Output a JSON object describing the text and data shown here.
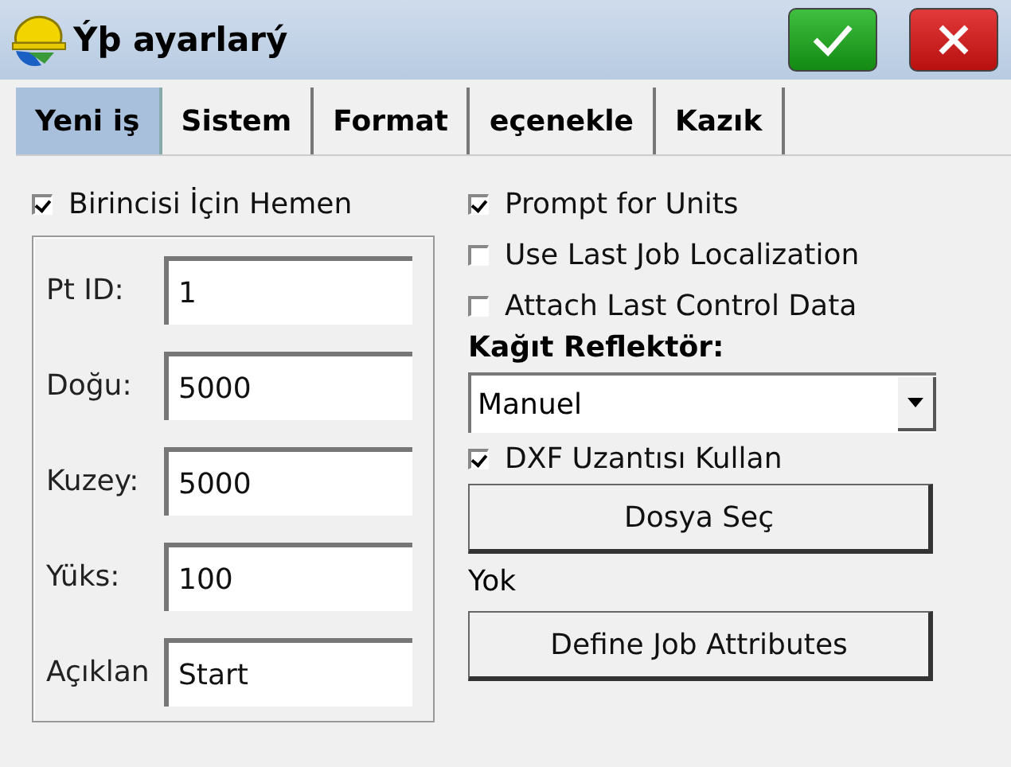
{
  "window": {
    "title": "Ýþ ayarlarý"
  },
  "title_buttons": [
    {
      "kind": "ok"
    },
    {
      "kind": "cancel"
    }
  ],
  "tabs": [
    {
      "label": "Yeni iş",
      "selected": true
    },
    {
      "label": "Sistem",
      "selected": false
    },
    {
      "label": "Format",
      "selected": false
    },
    {
      "label": "eçenekle",
      "selected": false
    },
    {
      "label": "Kazık",
      "selected": false
    }
  ],
  "left_checkbox": {
    "label": "Birincisi İçin Hemen",
    "checked": true
  },
  "fields": [
    {
      "label": "Pt ID:",
      "value": "1"
    },
    {
      "label": "Doğu:",
      "value": "5000"
    },
    {
      "label": "Kuzey:",
      "value": "5000"
    },
    {
      "label": "Yüks:",
      "value": "100"
    },
    {
      "label": "Açıklan",
      "value": "Start"
    }
  ],
  "right_checkboxes": [
    {
      "label": "Prompt for Units",
      "checked": true
    },
    {
      "label": "Use Last Job Localization",
      "checked": false
    },
    {
      "label": "Attach Last Control Data",
      "checked": false
    }
  ],
  "reflector": {
    "label": "Kağıt Reflektör:",
    "value": "Manuel"
  },
  "dxf_checkbox": {
    "label": "DXF Uzantısı Kullan",
    "checked": true
  },
  "file_button": "Dosya Seç",
  "file_name": "Yok",
  "attributes_button": "Define Job Attributes"
}
